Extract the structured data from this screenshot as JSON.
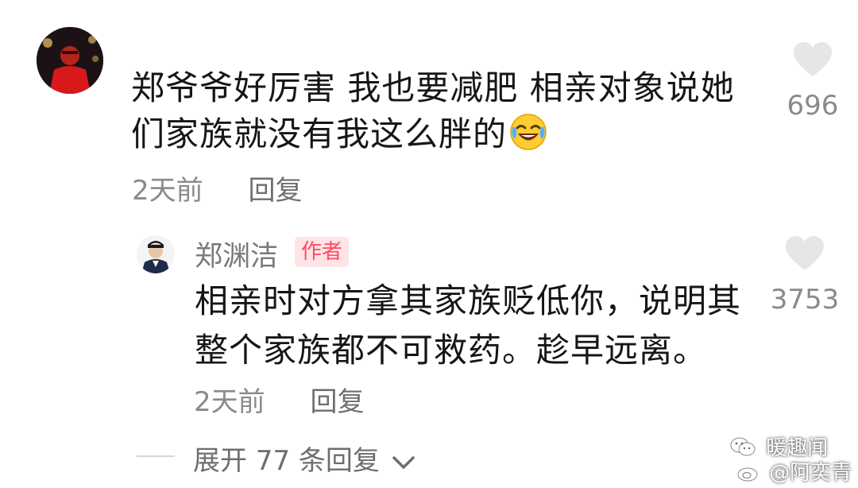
{
  "comment": {
    "text_line1": "郑爷爷好厉害 我也要减肥 相亲对象说她",
    "text_line2": "们家族就没有我这么胖的",
    "emoji": "laugh-cry-emoji",
    "time": "2天前",
    "reply_label": "回复",
    "likes": "696"
  },
  "reply": {
    "username": "郑渊洁",
    "badge": "作者",
    "text_line1": "相亲时对方拿其家族贬低你，说明其",
    "text_line2": "整个家族都不可救药。趁早远离。",
    "time": "2天前",
    "reply_label": "回复",
    "likes": "3753"
  },
  "expand": {
    "label": "展开 77 条回复"
  },
  "watermark": {
    "line1": "暖趣闻",
    "line2": "@阿奕青"
  },
  "colors": {
    "text": "#161616",
    "muted": "#8a8a8a",
    "badge_text": "#ff4a63",
    "badge_bg": "#ffe3e7",
    "heart": "#e6e6e6"
  }
}
